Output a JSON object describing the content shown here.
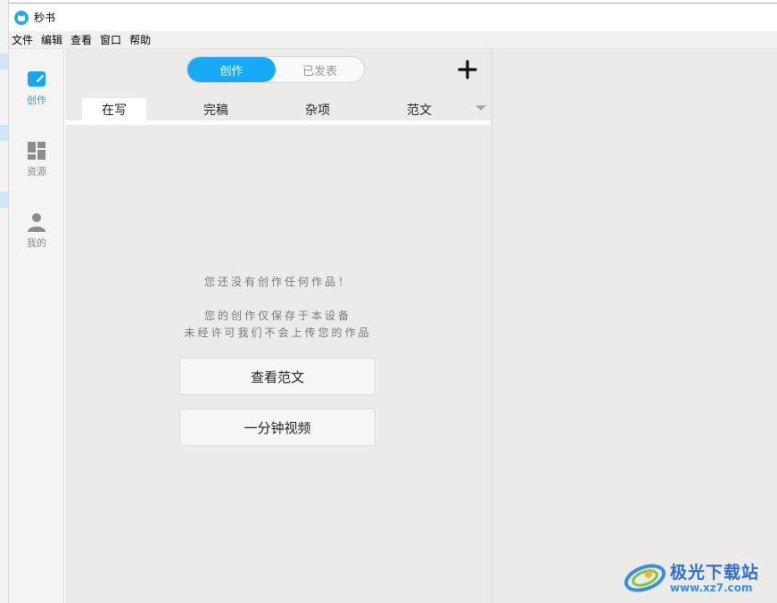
{
  "app": {
    "title": "秒书"
  },
  "menu": [
    "文件",
    "编辑",
    "查看",
    "窗口",
    "帮助"
  ],
  "nav": [
    {
      "label": "创作",
      "icon": "compose-icon",
      "active": true
    },
    {
      "label": "资源",
      "icon": "grid-icon",
      "active": false
    },
    {
      "label": "我的",
      "icon": "user-icon",
      "active": false
    }
  ],
  "segment": {
    "options": [
      "创作",
      "已发表"
    ],
    "selected": "创作"
  },
  "tabs": [
    {
      "label": "在写",
      "active": true
    },
    {
      "label": "完稿",
      "active": false
    },
    {
      "label": "杂项",
      "active": false
    },
    {
      "label": "范文",
      "active": false
    }
  ],
  "empty": {
    "line1": "您还没有创作任何作品！",
    "line2": "您的创作仅保存于本设备",
    "line3": "未经许可我们不会上传您的作品"
  },
  "buttons": {
    "samples": "查看范文",
    "video": "一分钟视频"
  },
  "watermark": {
    "title": "极光下载站",
    "url": "www.xz7.com"
  },
  "colors": {
    "accent": "#19aaf7",
    "panel": "#edebe9"
  }
}
